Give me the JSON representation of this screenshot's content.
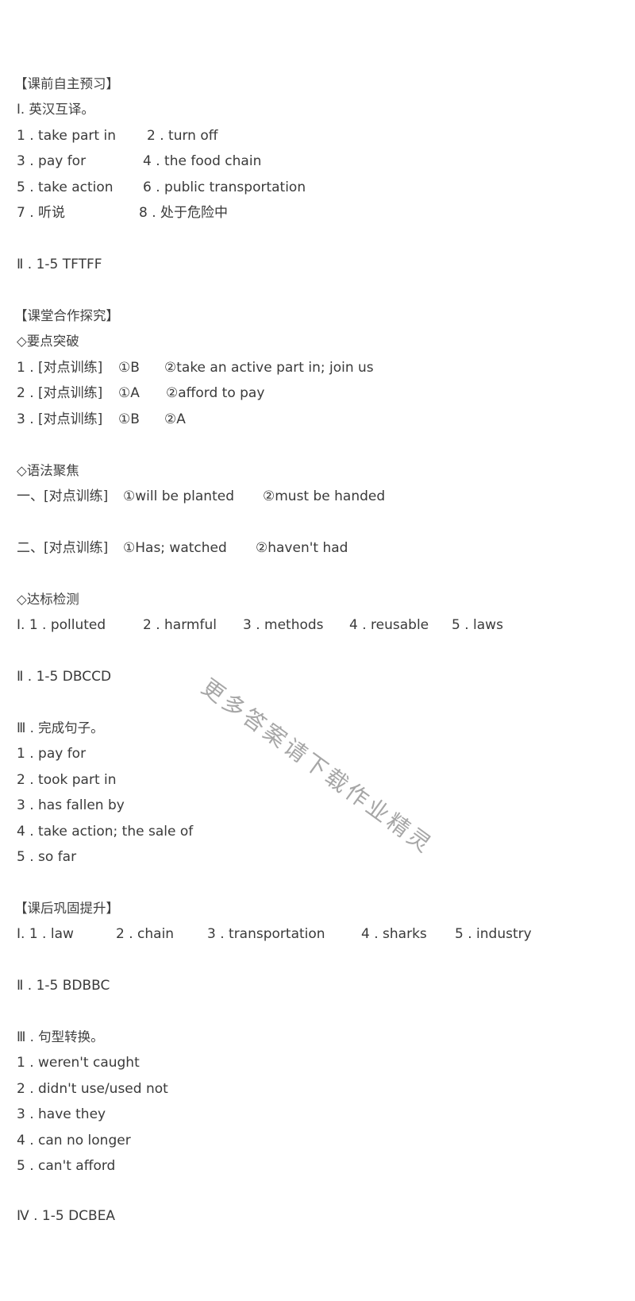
{
  "sections": {
    "preview": {
      "title": "【课前自主预习】",
      "part1_title": "Ⅰ. 英汉互译。",
      "rows": [
        [
          "1 . take part in",
          "2 . turn off"
        ],
        [
          "3 . pay for",
          "4 . the food chain"
        ],
        [
          "5 .  take action",
          "6 . public transportation"
        ],
        [
          "7 . 听说",
          "8 . 处于危险中"
        ]
      ],
      "part2": "Ⅱ . 1-5 TFTFF"
    },
    "classroom": {
      "title": "【课堂合作探究】",
      "key_points": {
        "title": "◇要点突破",
        "rows": [
          [
            "1 . [对点训练]",
            "①B",
            "②take an active part in; join us"
          ],
          [
            "2 . [对点训练]",
            "①A",
            "②afford to pay"
          ],
          [
            "3 . [对点训练]",
            "①B",
            "②A"
          ]
        ]
      },
      "grammar": {
        "title": "◇语法聚焦",
        "rows": [
          [
            "一、[对点训练]",
            "①will be planted",
            "②must be handed"
          ],
          [
            "二、[对点训练]",
            "①Has; watched",
            "②haven't had"
          ]
        ]
      },
      "check": {
        "title": "◇达标检测",
        "part1": [
          "Ⅰ. 1 .  polluted",
          "2 . harmful",
          "3 . methods",
          "4 . reusable",
          "5 .  laws"
        ],
        "part2": "Ⅱ . 1-5 DBCCD",
        "part3_title": "Ⅲ . 完成句子。",
        "part3": [
          "1 .  pay for",
          "2 . took part in",
          "3 . has fallen by",
          "4 .  take action; the sale of",
          "5 . so far"
        ]
      }
    },
    "after_class": {
      "title": "【课后巩固提升】",
      "part1": [
        "Ⅰ. 1 .  law",
        "2 . chain",
        "3 . transportation",
        "4 . sharks",
        "5 . industry"
      ],
      "part2": "Ⅱ . 1-5 BDBBC",
      "part3_title": "Ⅲ . 句型转换。",
      "part3": [
        "1 .  weren't caught",
        "2 . didn't use/used not",
        "3 .  have they",
        "4 . can no longer",
        "5 . can't afford"
      ],
      "part4": "Ⅳ .  1-5   DCBEA"
    }
  },
  "watermark": "更多答案请下载作业精灵",
  "colors": {
    "text": "#3a3a3a",
    "watermark": "#a6a6a6",
    "background": "#ffffff"
  }
}
